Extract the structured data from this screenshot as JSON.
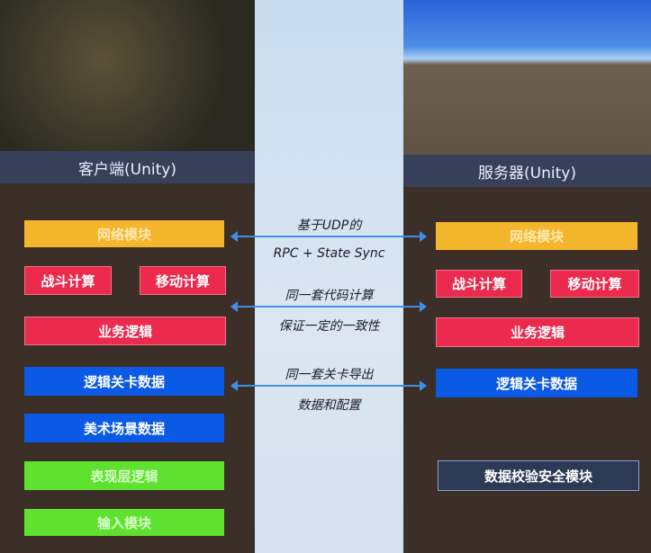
{
  "client": {
    "title": "客户端(Unity)",
    "modules": [
      "网络模块",
      "战斗计算",
      "移动计算",
      "业务逻辑",
      "逻辑关卡数据",
      "美术场景数据",
      "表现层逻辑",
      "输入模块"
    ]
  },
  "server": {
    "title": "服务器(Unity)",
    "modules": [
      "网络模块",
      "战斗计算",
      "移动计算",
      "业务逻辑",
      "逻辑关卡数据",
      "数据校验安全模块"
    ]
  },
  "links": [
    {
      "line1": "基于UDP的",
      "line2": "RPC + State Sync"
    },
    {
      "line1": "同一套代码计算",
      "line2": "保证一定的一致性"
    },
    {
      "line1": "同一套关卡导出",
      "line2": "数据和配置"
    }
  ],
  "colors": {
    "network": "#f4b62c",
    "logic": "#ec2a4d",
    "data": "#0b5ae6",
    "presentation": "#5ee12f",
    "security": "#2c3a56"
  }
}
